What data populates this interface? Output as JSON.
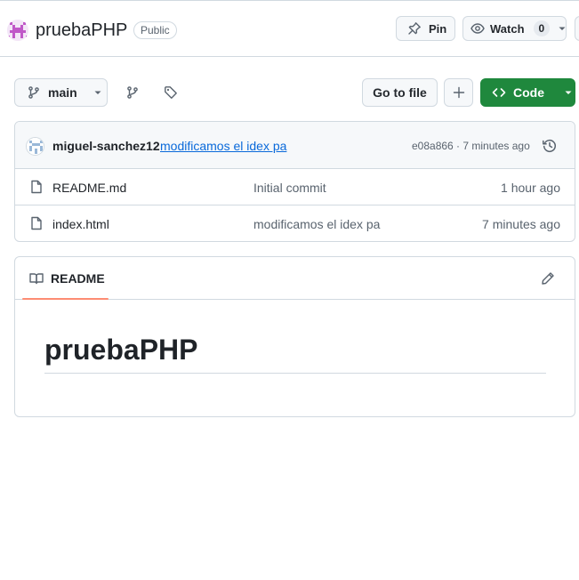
{
  "repo": {
    "name": "pruebaPHP",
    "visibility": "Public"
  },
  "header_actions": {
    "pin_label": "Pin",
    "watch_label": "Watch",
    "watch_count": "0"
  },
  "toolbar": {
    "branch": "main",
    "goto_file_label": "Go to file",
    "add_file_symbol": "+",
    "code_label": "Code"
  },
  "latest_commit": {
    "author": "miguel-sanchez12",
    "message": "modificamos el idex pa",
    "meta": "e08a866 · 7 minutes ago"
  },
  "files": [
    {
      "name": "README.md",
      "commit_message": "Initial commit",
      "age": "1 hour ago"
    },
    {
      "name": "index.html",
      "commit_message": "modificamos el idex pa",
      "age": "7 minutes ago"
    }
  ],
  "readme": {
    "tab_label": "README",
    "heading": "pruebaPHP"
  },
  "colors": {
    "accent_green": "#1f883d",
    "link_blue": "#0969da",
    "tab_underline": "#fd8c73",
    "border": "#d1d9e0",
    "avatar_purple": "#c058c8"
  },
  "icons": [
    "repo-avatar",
    "pin-icon",
    "eye-icon",
    "chevron-down-icon",
    "git-branch-icon",
    "tag-icon",
    "code-icon",
    "plus-icon",
    "user-avatar",
    "history-icon",
    "file-icon",
    "book-icon",
    "pencil-icon"
  ]
}
